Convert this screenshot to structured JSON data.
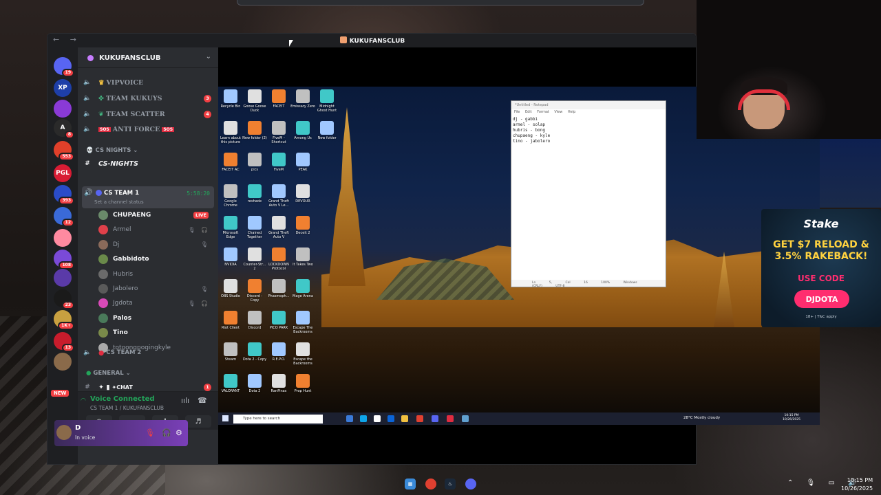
{
  "window": {
    "title": "KUKUFANSCLUB",
    "nav": "← →"
  },
  "rail": {
    "servers": [
      {
        "label": "",
        "badge": "19",
        "color": "#5865f2"
      },
      {
        "label": "XP",
        "badge": "",
        "color": "#1e3fa8"
      },
      {
        "label": "",
        "badge": "",
        "color": "#8a3ad6"
      },
      {
        "label": "A",
        "badge": "8",
        "color": "#2a2a2a"
      },
      {
        "label": "",
        "badge": "553",
        "color": "#e0402a"
      },
      {
        "label": "PGL",
        "badge": "",
        "color": "#d81c34"
      },
      {
        "label": "",
        "badge": "393",
        "color": "#2a4cc8"
      },
      {
        "label": "",
        "badge": "12",
        "color": "#3a6ad8"
      },
      {
        "label": "",
        "badge": "",
        "color": "#ff8aa0"
      },
      {
        "label": "",
        "badge": "108",
        "color": "#7a4ad8"
      },
      {
        "label": "",
        "badge": "",
        "color": "#5a3aa8"
      },
      {
        "label": "",
        "badge": "23",
        "color": "#1a1a1a"
      },
      {
        "label": "",
        "badge": "1K+",
        "color": "#c8a040"
      },
      {
        "label": "",
        "badge": "13",
        "color": "#c81c2c"
      },
      {
        "label": "",
        "badge": "",
        "color": "#8a6a4a"
      }
    ],
    "new_tag": "NEW"
  },
  "server": {
    "name": "KUKUFANSCLUB",
    "channels": [
      {
        "label": "VIPVOICE",
        "count": ""
      },
      {
        "label": "TEAM KUKUYS",
        "count": "3"
      },
      {
        "label": "TEAM SCATTER",
        "count": "4"
      },
      {
        "label": "ANTI FORCE",
        "count": ""
      }
    ],
    "category_cs": "CS NIGHTS",
    "text_channel_cs": "CS-NIGHTS",
    "current_channel": {
      "name": "CS TEAM 1",
      "timer": "5:58:20",
      "status": "Set a channel status"
    },
    "members": [
      {
        "name": "CHUPAENG",
        "online": true,
        "live": "LIVE",
        "icons": "",
        "color": "#6a8a6a"
      },
      {
        "name": "Armel",
        "online": false,
        "live": "",
        "icons": "🎙 🎧",
        "color": "#e0404a"
      },
      {
        "name": "Dj",
        "online": false,
        "live": "",
        "icons": "🎙",
        "color": "#8a6a5a"
      },
      {
        "name": "Gabbidoto",
        "online": true,
        "live": "",
        "icons": "",
        "color": "#6a8a4a"
      },
      {
        "name": "Hubris",
        "online": false,
        "live": "",
        "icons": "",
        "color": "#6a6a6a"
      },
      {
        "name": "Jabolero",
        "online": false,
        "live": "",
        "icons": "🎙",
        "color": "#5a5a5a"
      },
      {
        "name": "Jgdota",
        "online": false,
        "live": "",
        "icons": "🎙 🎧",
        "color": "#d84ab8"
      },
      {
        "name": "Palos",
        "online": true,
        "live": "",
        "icons": "",
        "color": "#4a7a5a"
      },
      {
        "name": "Tino",
        "online": true,
        "live": "",
        "icons": "",
        "color": "#7a8a4a"
      },
      {
        "name": "totoongpogingkyle",
        "online": false,
        "live": "",
        "icons": "",
        "color": "#aaaaaa"
      }
    ],
    "channel_cs2": "CS TEAM 2",
    "category_general": "GENERAL",
    "text_channel_chat": "✦CHAT",
    "chat_count": "1"
  },
  "voice": {
    "status": "Voice Connected",
    "location": "CS TEAM 1 / KUKUFANSCLUB"
  },
  "user": {
    "name": "D",
    "status": "In voice"
  },
  "desktop": {
    "icons": [
      [
        "Recycle Bin",
        "Goose Goose Duck",
        "FACEIT",
        "Emissary Zero",
        "Midnight Ghost Hunt"
      ],
      [
        "Learn about this picture",
        "New folder (2)",
        "FiveM - Shortcut",
        "Among Us",
        "New folder"
      ],
      [
        "FACEIT AC",
        "pics",
        "FiveM",
        "PEAK",
        ""
      ],
      [
        "Google Chrome",
        "reshade",
        "Grand Theft Auto V Le...",
        "DEVOUR",
        ""
      ],
      [
        "Microsoft Edge",
        "Chained Together",
        "Grand Theft Auto V",
        "Deceit 2",
        ""
      ],
      [
        "NVIDIA",
        "Counter-Str... 2",
        "LOCKDOWN Protocol",
        "It Takes Two",
        ""
      ],
      [
        "OBS Studio",
        "Discord - Copy",
        "Phasmoph...",
        "Mage Arena",
        ""
      ],
      [
        "Riot Client",
        "Discord",
        "PICO PARK",
        "Escape The Backrooms",
        ""
      ],
      [
        "Steam",
        "Dota 2 - Copy",
        "R.E.P.O.",
        "Escape the Backrooms",
        ""
      ],
      [
        "VALORANT",
        "Dota 2",
        "RanPinas",
        "Prop Hunt",
        ""
      ]
    ],
    "notepad": {
      "title": "*Untitled - Notepad",
      "menu": "File Edit Format View Help",
      "lines": [
        "dj - gabbi",
        "armel - solap",
        "hubris - bong",
        "chupaeng - kyle",
        "tino - jabolero"
      ],
      "status": "Ln 5, Col 16   100%   Windows (CRLF)   UTF-8"
    },
    "search_placeholder": "Type here to search",
    "weather": "28°C  Mostly cloudy",
    "time": "10:15 PM",
    "date": "10/26/2025"
  },
  "ad": {
    "brand": "Stake",
    "promo": "GET $7 RELOAD & 3.5% RAKEBACK!",
    "use_code": "USE CODE",
    "code": "DJDOTA",
    "terms": "18+ | T&C apply"
  },
  "host": {
    "time": "10:15 PM",
    "date": "10/26/2025"
  }
}
